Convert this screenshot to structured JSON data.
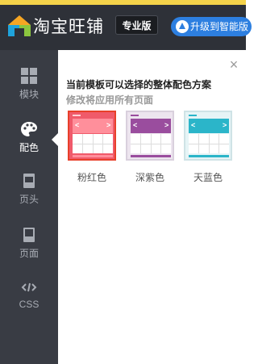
{
  "header": {
    "app_name": "淘宝旺铺",
    "edition": "专业版",
    "upgrade_label": "升级到智能版"
  },
  "sidebar": {
    "items": [
      {
        "label": "模块",
        "icon": "grid-icon",
        "active": false
      },
      {
        "label": "配色",
        "icon": "palette-icon",
        "active": true
      },
      {
        "label": "页头",
        "icon": "page-header-icon",
        "active": false
      },
      {
        "label": "页面",
        "icon": "page-icon",
        "active": false
      },
      {
        "label": "CSS",
        "icon": "code-icon",
        "active": false
      }
    ]
  },
  "panel": {
    "close_icon": "close-icon",
    "title": "当前模板可以选择的整体配色方案",
    "subtitle": "修改将应用所有页面",
    "schemes": [
      {
        "label": "粉红色",
        "color": "#f05a6a",
        "selected": true
      },
      {
        "label": "深紫色",
        "color": "#9a4d9e",
        "selected": false
      },
      {
        "label": "天蓝色",
        "color": "#2bb5c9",
        "selected": false
      }
    ]
  },
  "colors": {
    "header_bg": "#2e3138",
    "sidebar_bg": "#393c44",
    "accent_yellow": "#f5d34a",
    "upgrade_blue": "#2d7fe0",
    "selected_border": "#e8402a"
  }
}
